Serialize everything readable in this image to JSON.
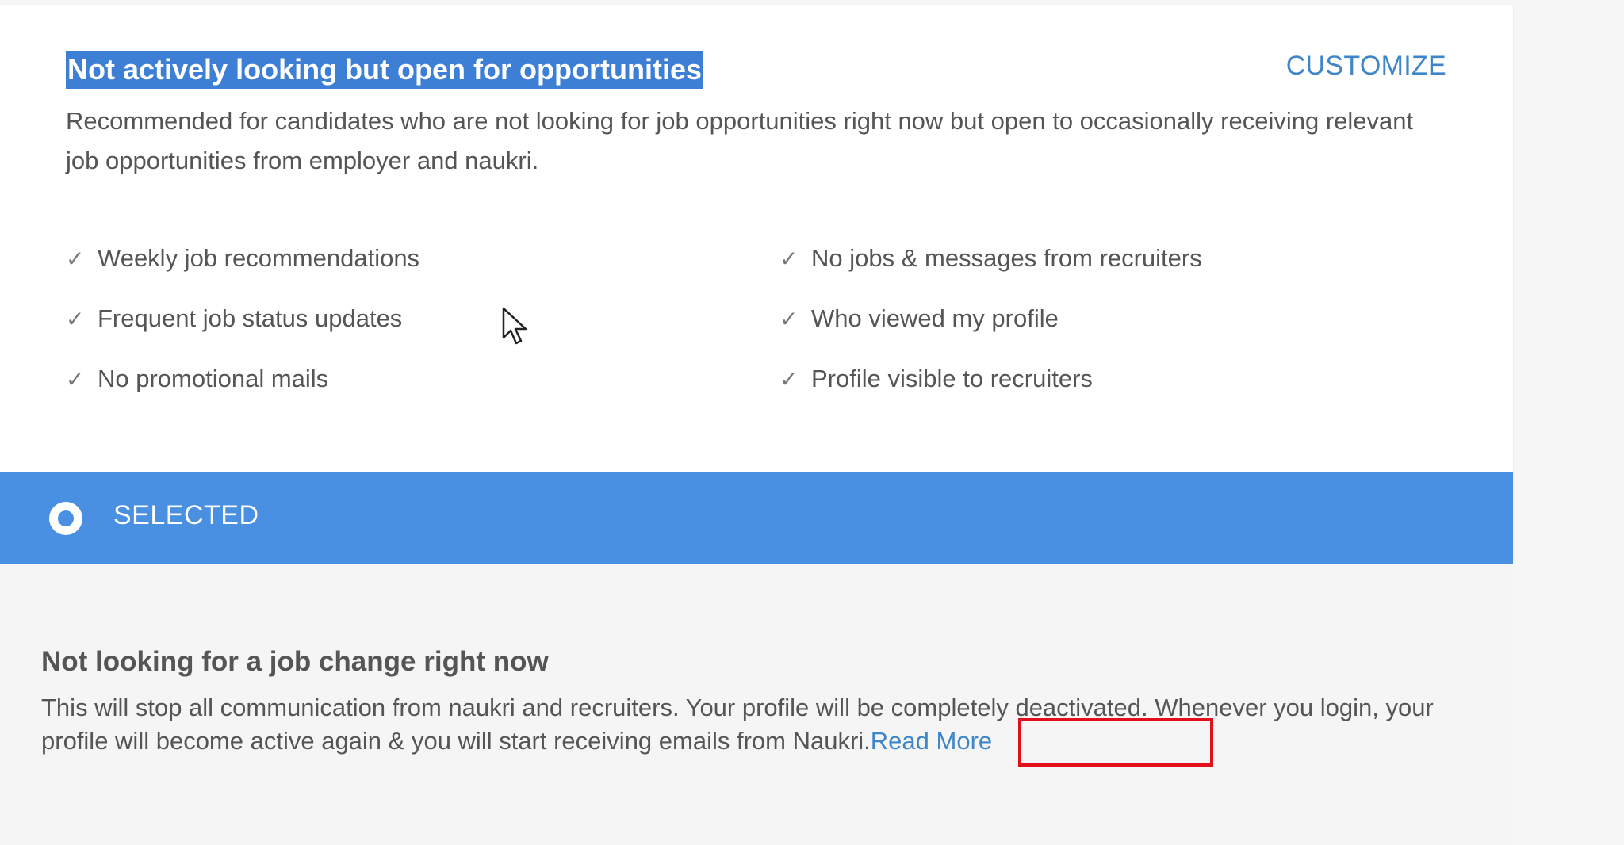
{
  "option1": {
    "title": "Not actively looking but open for opportunities",
    "customize_label": "CUSTOMIZE",
    "description": "Recommended for candidates who are not looking for job opportunities right now but open to occasionally receiving relevant job opportunities from employer and naukri.",
    "check_glyph": "✓",
    "features_left": [
      "Weekly job recommendations",
      "Frequent job status updates",
      "No promotional mails"
    ],
    "features_right": [
      "No jobs & messages from recruiters",
      "Who viewed my profile",
      "Profile visible to recruiters"
    ],
    "selected_label": "SELECTED"
  },
  "option2": {
    "title": "Not looking for a job change right now",
    "description": "This will stop all communication from naukri and recruiters. Your profile will be completely deactivated. Whenever you login, your profile will become active again & you will start receiving emails from Naukri.",
    "read_more_label": "Read More"
  },
  "colors": {
    "accent": "#4a90e2",
    "link": "#3f86c9",
    "highlight_border": "#e3101c"
  },
  "icons": {
    "radio": "radio-selected-icon",
    "check": "check-icon",
    "cursor": "mouse-pointer-icon"
  }
}
